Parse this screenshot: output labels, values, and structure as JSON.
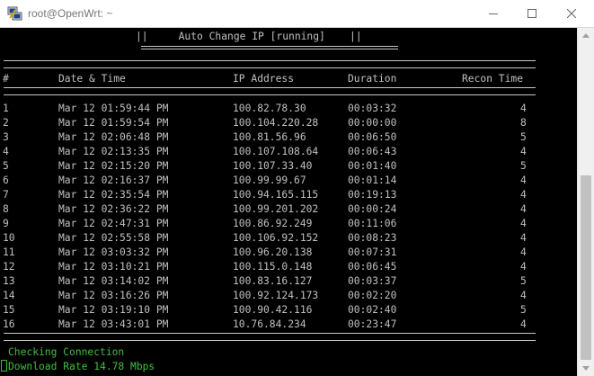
{
  "window": {
    "title": "root@OpenWrt: ~",
    "icon": "putty-icon"
  },
  "terminal": {
    "banner": "||     Auto Change IP [running]    ||",
    "columns": {
      "num": "#",
      "date": "Date & Time",
      "ip": "IP Address",
      "duration": "Duration",
      "recon": "Recon Time"
    },
    "rows": [
      {
        "num": "1",
        "date": "Mar 12 01:59:44 PM",
        "ip": "100.82.78.30",
        "duration": "00:03:32",
        "recon": "4"
      },
      {
        "num": "2",
        "date": "Mar 12 01:59:54 PM",
        "ip": "100.104.220.28",
        "duration": "00:00:00",
        "recon": "8"
      },
      {
        "num": "3",
        "date": "Mar 12 02:06:48 PM",
        "ip": "100.81.56.96",
        "duration": "00:06:50",
        "recon": "5"
      },
      {
        "num": "4",
        "date": "Mar 12 02:13:35 PM",
        "ip": "100.107.108.64",
        "duration": "00:06:43",
        "recon": "4"
      },
      {
        "num": "5",
        "date": "Mar 12 02:15:20 PM",
        "ip": "100.107.33.40",
        "duration": "00:01:40",
        "recon": "5"
      },
      {
        "num": "6",
        "date": "Mar 12 02:16:37 PM",
        "ip": "100.99.99.67",
        "duration": "00:01:14",
        "recon": "4"
      },
      {
        "num": "7",
        "date": "Mar 12 02:35:54 PM",
        "ip": "100.94.165.115",
        "duration": "00:19:13",
        "recon": "4"
      },
      {
        "num": "8",
        "date": "Mar 12 02:36:22 PM",
        "ip": "100.99.201.202",
        "duration": "00:00:24",
        "recon": "4"
      },
      {
        "num": "9",
        "date": "Mar 12 02:47:31 PM",
        "ip": "100.86.92.249",
        "duration": "00:11:06",
        "recon": "4"
      },
      {
        "num": "10",
        "date": "Mar 12 02:55:58 PM",
        "ip": "100.106.92.152",
        "duration": "00:08:23",
        "recon": "4"
      },
      {
        "num": "11",
        "date": "Mar 12 03:03:32 PM",
        "ip": "100.96.20.138",
        "duration": "00:07:31",
        "recon": "4"
      },
      {
        "num": "12",
        "date": "Mar 12 03:10:21 PM",
        "ip": "100.115.0.148",
        "duration": "00:06:45",
        "recon": "4"
      },
      {
        "num": "13",
        "date": "Mar 12 03:14:02 PM",
        "ip": "100.83.16.127",
        "duration": "00:03:37",
        "recon": "5"
      },
      {
        "num": "14",
        "date": "Mar 12 03:16:26 PM",
        "ip": "100.92.124.173",
        "duration": "00:02:20",
        "recon": "4"
      },
      {
        "num": "15",
        "date": "Mar 12 03:19:10 PM",
        "ip": "100.90.42.116",
        "duration": "00:02:40",
        "recon": "5"
      },
      {
        "num": "16",
        "date": "Mar 12 03:43:01 PM",
        "ip": "10.76.84.234",
        "duration": "00:23:47",
        "recon": "4"
      }
    ],
    "status": "Checking Connection",
    "download": "Download Rate 14.78 Mbps"
  },
  "colors": {
    "text": "#c0c0c0",
    "status": "#3fbf3f",
    "background": "#000000"
  }
}
